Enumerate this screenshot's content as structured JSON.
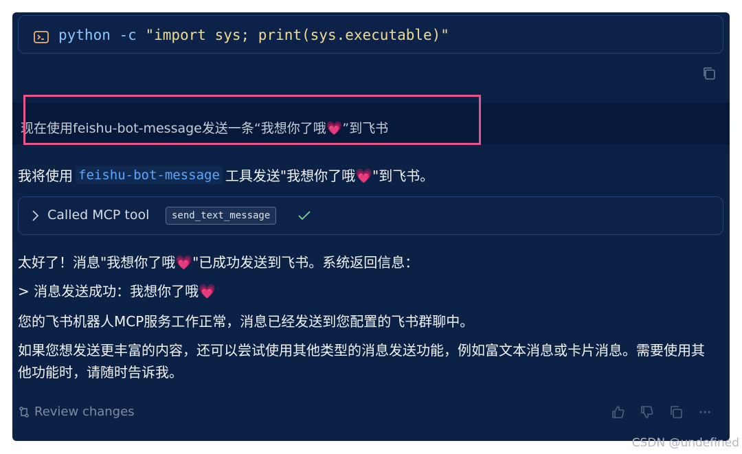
{
  "command": {
    "text_prefix": "python -c ",
    "text_string": "\"import sys; print(sys.executable)\""
  },
  "user_message": {
    "text": "现在使用feishu-bot-message发送一条“我想你了哦💗”到飞书"
  },
  "assistant": {
    "line1_before": "我将使用",
    "line1_code": "feishu-bot-message",
    "line1_after": "工具发送\"我想你了哦💗\"到飞书。",
    "tool_call": {
      "label": "Called MCP tool",
      "tool_name": "send_text_message"
    },
    "para1": "太好了！消息\"我想你了哦💗\"已成功发送到飞书。系统返回信息：",
    "para2": "> 消息发送成功：我想你了哦💗",
    "para3": "您的飞书机器人MCP服务工作正常，消息已经发送到您配置的飞书群聊中。",
    "para4": "如果您想发送更丰富的内容，还可以尝试使用其他类型的消息发送功能，例如富文本消息或卡片消息。需要使用其他功能时，请随时告诉我。"
  },
  "footer": {
    "review_label": "Review changes",
    "icons": [
      "thumbs-up-icon",
      "thumbs-down-icon",
      "copy-icon",
      "more-icon"
    ]
  },
  "watermark": "CSDN @undefined",
  "colors": {
    "background": "#0b2145",
    "highlight_border": "#e8558b",
    "inline_code": "#5aa7ff",
    "check": "#7bd88f"
  }
}
